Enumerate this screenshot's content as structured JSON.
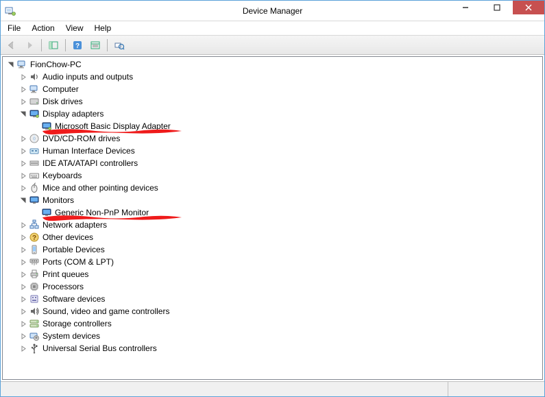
{
  "window": {
    "title": "Device Manager"
  },
  "menu": {
    "items": [
      "File",
      "Action",
      "View",
      "Help"
    ]
  },
  "toolbar": {
    "back": "Back",
    "forward": "Forward",
    "showhide": "Show/Hide Console Tree",
    "help": "Help",
    "properties": "Properties",
    "scan": "Scan for hardware changes"
  },
  "tree": {
    "root": "FionChow-PC",
    "items": [
      {
        "label": "Audio inputs and outputs",
        "icon": "audio-icon",
        "expanded": false,
        "hasChildren": true
      },
      {
        "label": "Computer",
        "icon": "computer-icon",
        "expanded": false,
        "hasChildren": true
      },
      {
        "label": "Disk drives",
        "icon": "disk-icon",
        "expanded": false,
        "hasChildren": true
      },
      {
        "label": "Display adapters",
        "icon": "display-icon",
        "expanded": true,
        "hasChildren": true,
        "children": [
          {
            "label": "Microsoft Basic Display Adapter",
            "icon": "display-icon"
          }
        ],
        "scribble": true
      },
      {
        "label": "DVD/CD-ROM drives",
        "icon": "cdrom-icon",
        "expanded": false,
        "hasChildren": true,
        "obscured": true
      },
      {
        "label": "Human Interface Devices",
        "icon": "hid-icon",
        "expanded": false,
        "hasChildren": true
      },
      {
        "label": "IDE ATA/ATAPI controllers",
        "icon": "ide-icon",
        "expanded": false,
        "hasChildren": true
      },
      {
        "label": "Keyboards",
        "icon": "keyboard-icon",
        "expanded": false,
        "hasChildren": true
      },
      {
        "label": "Mice and other pointing devices",
        "icon": "mouse-icon",
        "expanded": false,
        "hasChildren": true
      },
      {
        "label": "Monitors",
        "icon": "monitor-icon",
        "expanded": true,
        "hasChildren": true,
        "children": [
          {
            "label": "Generic Non-PnP Monitor",
            "icon": "monitor-icon"
          }
        ],
        "scribble": true
      },
      {
        "label": "Network adapters",
        "icon": "network-icon",
        "expanded": false,
        "hasChildren": true,
        "obscured": true
      },
      {
        "label": "Other devices",
        "icon": "other-icon",
        "expanded": false,
        "hasChildren": true
      },
      {
        "label": "Portable Devices",
        "icon": "portable-icon",
        "expanded": false,
        "hasChildren": true
      },
      {
        "label": "Ports (COM & LPT)",
        "icon": "ports-icon",
        "expanded": false,
        "hasChildren": true
      },
      {
        "label": "Print queues",
        "icon": "printer-icon",
        "expanded": false,
        "hasChildren": true
      },
      {
        "label": "Processors",
        "icon": "processor-icon",
        "expanded": false,
        "hasChildren": true
      },
      {
        "label": "Software devices",
        "icon": "software-icon",
        "expanded": false,
        "hasChildren": true
      },
      {
        "label": "Sound, video and game controllers",
        "icon": "sound-icon",
        "expanded": false,
        "hasChildren": true
      },
      {
        "label": "Storage controllers",
        "icon": "storage-icon",
        "expanded": false,
        "hasChildren": true
      },
      {
        "label": "System devices",
        "icon": "system-icon",
        "expanded": false,
        "hasChildren": true
      },
      {
        "label": "Universal Serial Bus controllers",
        "icon": "usb-icon",
        "expanded": false,
        "hasChildren": true
      }
    ]
  },
  "status": {
    "left": "",
    "right": ""
  }
}
